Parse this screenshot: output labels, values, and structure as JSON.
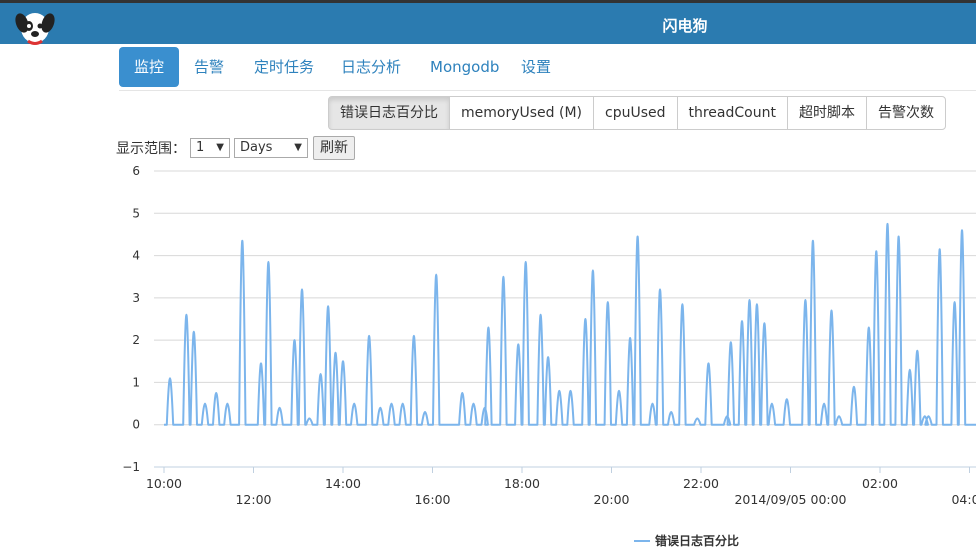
{
  "header": {
    "title": "闪电狗",
    "logo": "dog-logo-icon"
  },
  "nav": {
    "items": [
      {
        "label": "监控",
        "active": true
      },
      {
        "label": "告警"
      },
      {
        "label": "定时任务"
      },
      {
        "label": "日志分析"
      },
      {
        "label": "Mongodb"
      },
      {
        "label": "设置"
      }
    ]
  },
  "metrics": {
    "items": [
      {
        "label": "错误日志百分比",
        "active": true
      },
      {
        "label": "memoryUsed (M)"
      },
      {
        "label": "cpuUsed"
      },
      {
        "label": "threadCount"
      },
      {
        "label": "超时脚本"
      },
      {
        "label": "告警次数"
      }
    ]
  },
  "range": {
    "label": "显示范围：",
    "value": "1",
    "unit": "Days",
    "refresh_label": "刷新"
  },
  "chart_data": {
    "type": "line",
    "y_ticks": [
      "6",
      "5",
      "4",
      "3",
      "2",
      "1",
      "0",
      "−1"
    ],
    "ylim": [
      -1,
      6
    ],
    "x_ticks": [
      "10:00",
      "12:00",
      "14:00",
      "16:00",
      "18:00",
      "20:00",
      "22:00",
      "2014/09/05 00:00",
      "02:00",
      "04:00"
    ],
    "grid": true,
    "legend_position": "bottom",
    "series": [
      {
        "name": "错误日志百分比",
        "color": "#7cb5ec",
        "peaks": [
          [
            "10:08",
            1.1
          ],
          [
            "10:30",
            2.6
          ],
          [
            "10:40",
            2.2
          ],
          [
            "10:55",
            0.5
          ],
          [
            "11:10",
            0.75
          ],
          [
            "11:25",
            0.5
          ],
          [
            "11:45",
            4.35
          ],
          [
            "12:10",
            1.45
          ],
          [
            "12:20",
            3.85
          ],
          [
            "12:35",
            0.4
          ],
          [
            "12:55",
            2.0
          ],
          [
            "13:05",
            3.2
          ],
          [
            "13:15",
            0.15
          ],
          [
            "13:30",
            1.2
          ],
          [
            "13:40",
            2.8
          ],
          [
            "13:50",
            1.7
          ],
          [
            "14:00",
            1.5
          ],
          [
            "14:15",
            0.5
          ],
          [
            "14:35",
            2.1
          ],
          [
            "14:50",
            0.4
          ],
          [
            "15:05",
            0.5
          ],
          [
            "15:20",
            0.5
          ],
          [
            "15:35",
            2.1
          ],
          [
            "15:50",
            0.3
          ],
          [
            "16:05",
            3.55
          ],
          [
            "16:40",
            0.75
          ],
          [
            "16:55",
            0.5
          ],
          [
            "17:10",
            0.4
          ],
          [
            "17:15",
            2.3
          ],
          [
            "17:35",
            3.5
          ],
          [
            "17:55",
            1.9
          ],
          [
            "18:05",
            3.85
          ],
          [
            "18:25",
            2.6
          ],
          [
            "18:35",
            1.6
          ],
          [
            "18:50",
            0.8
          ],
          [
            "19:05",
            0.8
          ],
          [
            "19:25",
            2.5
          ],
          [
            "19:35",
            3.65
          ],
          [
            "19:55",
            2.9
          ],
          [
            "20:10",
            0.8
          ],
          [
            "20:25",
            2.05
          ],
          [
            "20:35",
            4.45
          ],
          [
            "20:55",
            0.5
          ],
          [
            "21:05",
            3.2
          ],
          [
            "21:20",
            0.3
          ],
          [
            "21:35",
            2.85
          ],
          [
            "21:55",
            0.15
          ],
          [
            "22:10",
            1.45
          ],
          [
            "22:35",
            0.2
          ],
          [
            "22:40",
            1.95
          ],
          [
            "22:55",
            2.45
          ],
          [
            "23:05",
            2.95
          ],
          [
            "23:15",
            2.85
          ],
          [
            "23:25",
            2.4
          ],
          [
            "23:35",
            0.5
          ],
          [
            "23:55",
            0.6
          ],
          [
            "00:20",
            2.95
          ],
          [
            "00:30",
            4.35
          ],
          [
            "00:45",
            0.5
          ],
          [
            "00:55",
            2.7
          ],
          [
            "01:05",
            0.2
          ],
          [
            "01:25",
            0.9
          ],
          [
            "01:45",
            2.3
          ],
          [
            "01:55",
            4.1
          ],
          [
            "02:10",
            4.75
          ],
          [
            "02:25",
            4.45
          ],
          [
            "02:40",
            1.3
          ],
          [
            "02:50",
            1.75
          ],
          [
            "03:00",
            0.2
          ],
          [
            "03:05",
            0.2
          ],
          [
            "03:20",
            4.15
          ],
          [
            "03:40",
            2.9
          ],
          [
            "03:50",
            4.6
          ]
        ]
      }
    ]
  }
}
